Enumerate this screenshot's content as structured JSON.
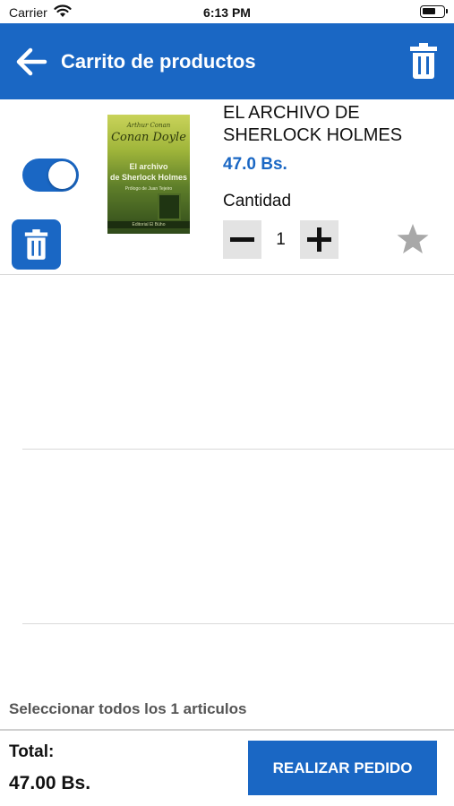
{
  "status_bar": {
    "carrier": "Carrier",
    "time": "6:13 PM",
    "icons": [
      "wifi-icon",
      "battery-icon"
    ]
  },
  "app_bar": {
    "title": "Carrito de productos",
    "background": "#1a67c4",
    "icons": [
      "arrow-left-icon",
      "trash-icon"
    ]
  },
  "cart": {
    "items": [
      {
        "selected": true,
        "cover": {
          "author_small": "Arthur Conan",
          "author": "Conan Doyle",
          "title_line1": "El archivo",
          "title_line2": "de Sherlock Holmes",
          "subtitle": "Prólogo de Juan Tejeiro",
          "publisher": "Editorial El Búho"
        },
        "title": "EL ARCHIVO DE SHERLOCK HOLMES",
        "price": "47.0 Bs.",
        "quantity_label": "Cantidad",
        "quantity": "1",
        "favorite": false
      }
    ]
  },
  "footer": {
    "select_all": "Seleccionar todos los 1 articulos",
    "total_label": "Total:",
    "total_value": "47.00 Bs.",
    "order_button": "REALIZAR PEDIDO"
  },
  "colors": {
    "accent": "#1a67c4",
    "star_inactive": "#a8a8a8"
  }
}
